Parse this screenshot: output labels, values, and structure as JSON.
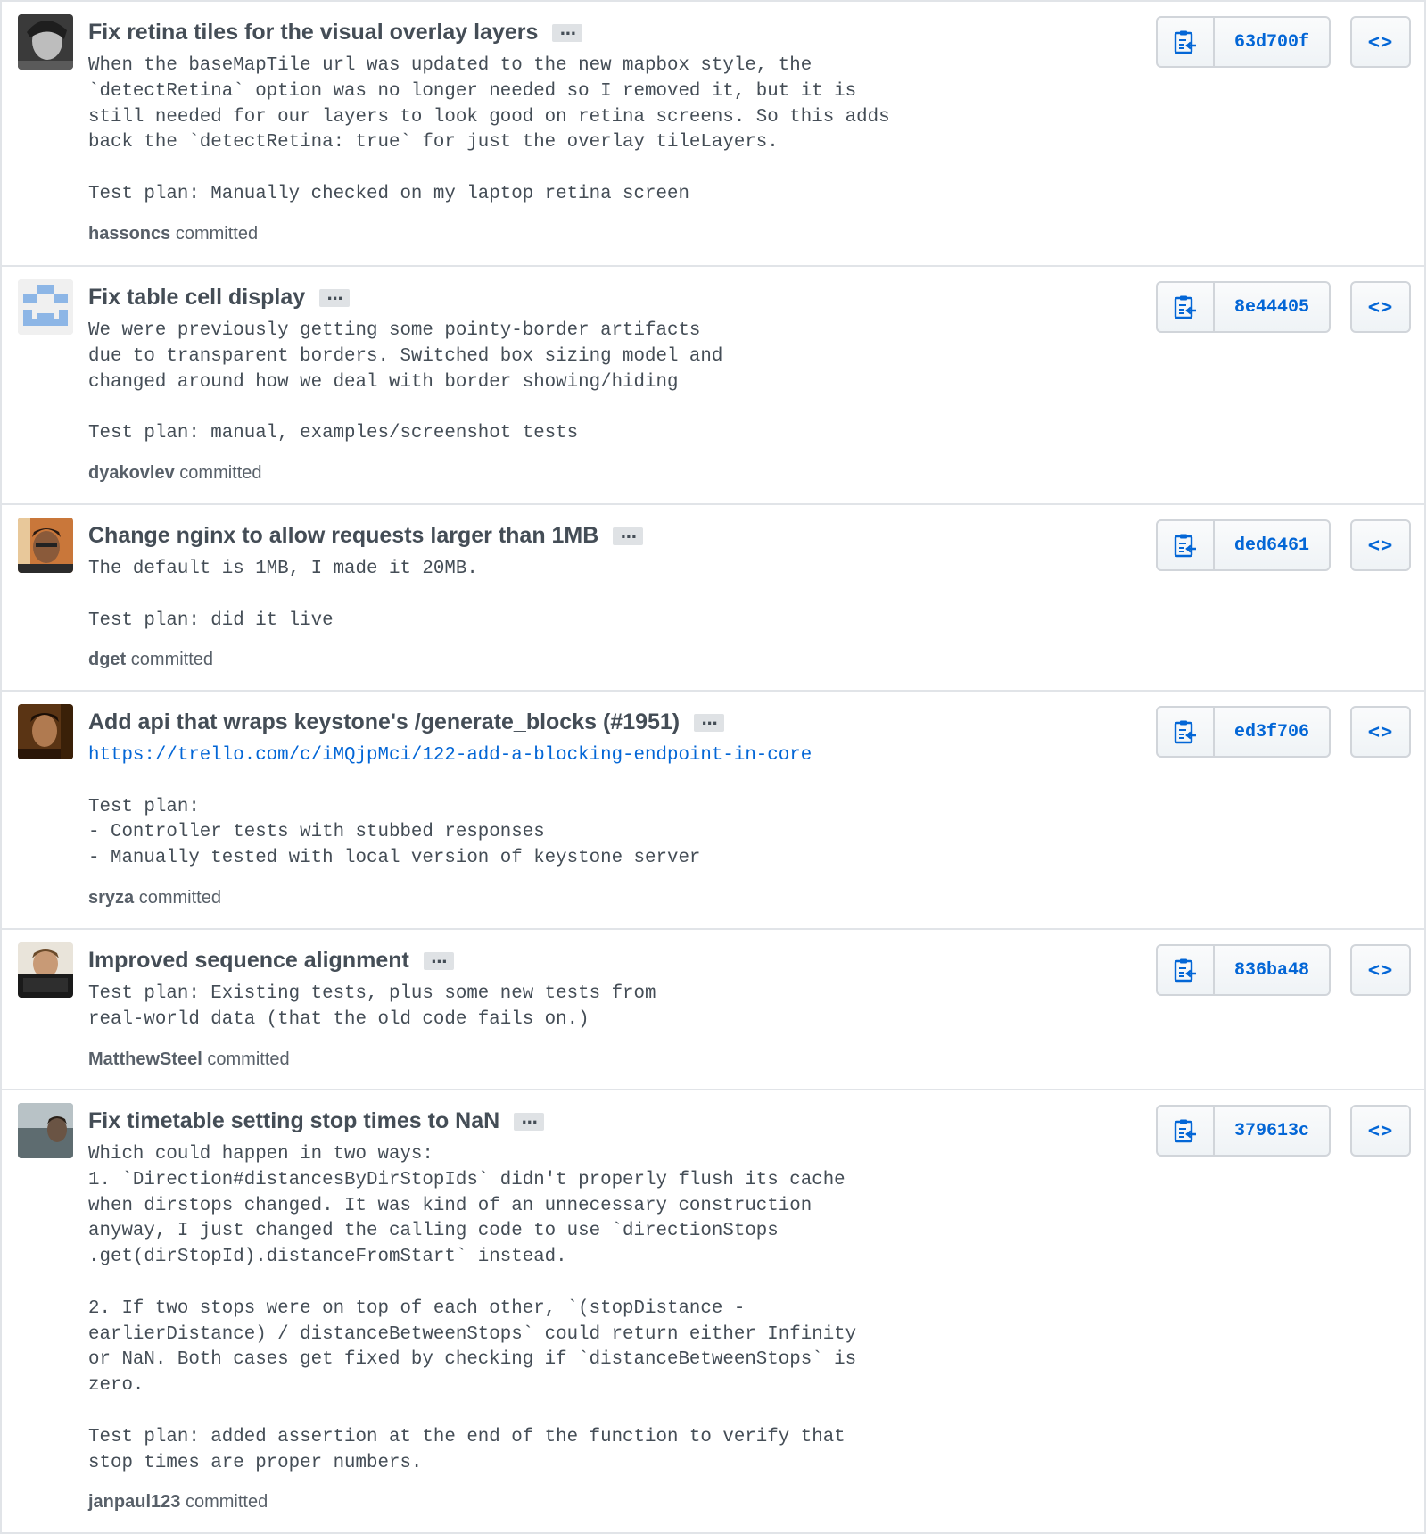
{
  "commits": [
    {
      "title": "Fix retina tiles for the visual overlay layers",
      "body": "When the baseMapTile url was updated to the new mapbox style, the\n`detectRetina` option was no longer needed so I removed it, but it is\nstill needed for our layers to look good on retina screens. So this adds\nback the `detectRetina: true` for just the overlay tileLayers.\n\nTest plan: Manually checked on my laptop retina screen",
      "author": "hassoncs",
      "action": "committed",
      "sha": "63d700f",
      "avatar": "photo-grey"
    },
    {
      "title": "Fix table cell display",
      "body": "We were previously getting some pointy-border artifacts\ndue to transparent borders. Switched box sizing model and\nchanged around how we deal with border showing/hiding\n\nTest plan: manual, examples/screenshot tests",
      "author": "dyakovlev",
      "action": "committed",
      "sha": "8e44405",
      "avatar": "identicon-blue"
    },
    {
      "title": "Change nginx to allow requests larger than 1MB",
      "body": "The default is 1MB, I made it 20MB.\n\nTest plan: did it live",
      "author": "dget",
      "action": "committed",
      "sha": "ded6461",
      "avatar": "photo-warm"
    },
    {
      "title": "Add api that wraps keystone's /generate_blocks (#1951)",
      "link": "https://trello.com/c/iMQjpMci/122-add-a-blocking-endpoint-in-core",
      "body": "\nTest plan:\n- Controller tests with stubbed responses\n- Manually tested with local version of keystone server",
      "author": "sryza",
      "action": "committed",
      "sha": "ed3f706",
      "avatar": "photo-dark"
    },
    {
      "title": "Improved sequence alignment",
      "body": "Test plan: Existing tests, plus some new tests from\nreal-world data (that the old code fails on.)",
      "author": "MatthewSteel",
      "action": "committed",
      "sha": "836ba48",
      "avatar": "photo-screen"
    },
    {
      "title": "Fix timetable setting stop times to NaN",
      "body": "Which could happen in two ways:\n1. `Direction#distancesByDirStopIds` didn't properly flush its cache\nwhen dirstops changed. It was kind of an unnecessary construction\nanyway, I just changed the calling code to use `directionStops\n.get(dirStopId).distanceFromStart` instead.\n\n2. If two stops were on top of each other, `(stopDistance -\nearlierDistance) / distanceBetweenStops` could return either Infinity\nor NaN. Both cases get fixed by checking if `distanceBetweenStops` is\nzero.\n\nTest plan: added assertion at the end of the function to verify that\nstop times are proper numbers.",
      "author": "janpaul123",
      "action": "committed",
      "sha": "379613c",
      "avatar": "photo-outdoor"
    }
  ],
  "ui": {
    "ellipsis_label": "…",
    "browse_label": "<>",
    "copy_icon": "clipboard-copy-icon",
    "browse_icon": "code-icon",
    "accent_color": "#0366d6"
  }
}
